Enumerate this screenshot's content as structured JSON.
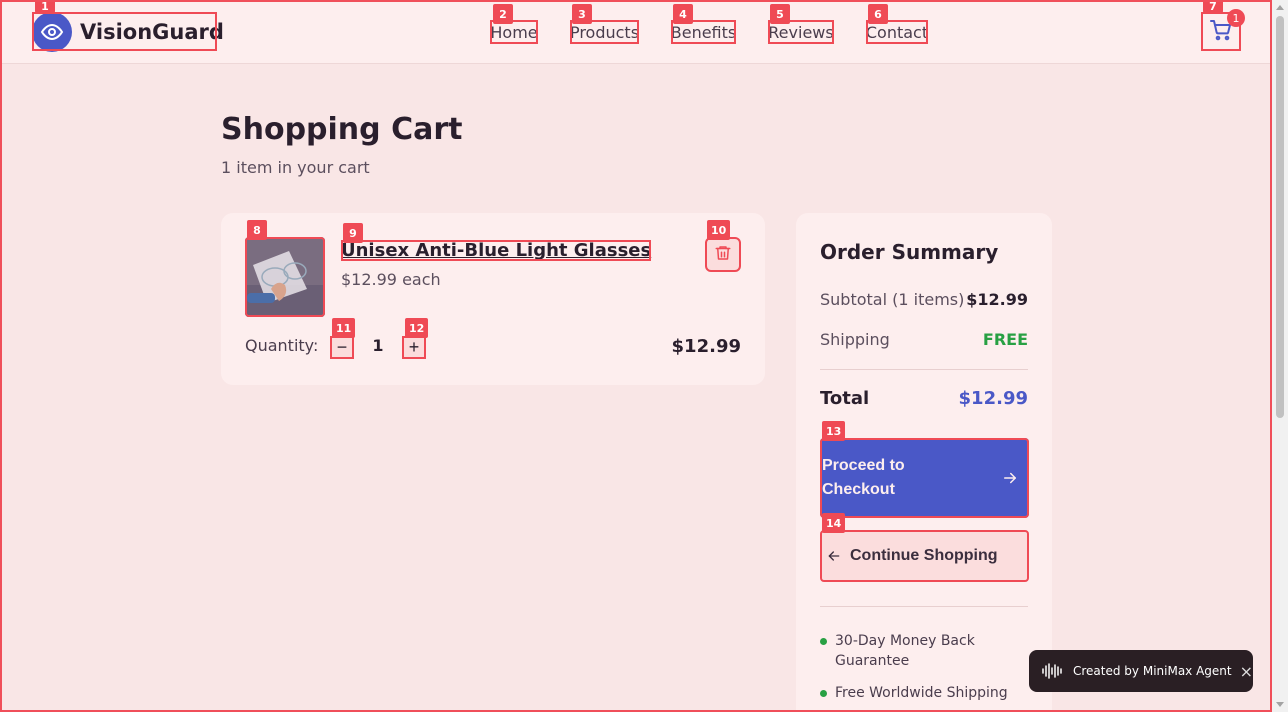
{
  "header": {
    "brand": "VisionGuard",
    "nav": [
      "Home",
      "Products",
      "Benefits",
      "Reviews",
      "Contact"
    ],
    "cart_count": "1"
  },
  "cart": {
    "title": "Shopping Cart",
    "subtitle": "1 item in your cart",
    "item": {
      "name": "Unisex Anti-Blue Light Glasses",
      "price_each": "$12.99 each",
      "quantity_label": "Quantity:",
      "quantity": "1",
      "decrement": "−",
      "increment": "+",
      "line_total": "$12.99"
    }
  },
  "summary": {
    "title": "Order Summary",
    "subtotal_label": "Subtotal (1 items)",
    "subtotal_value": "$12.99",
    "shipping_label": "Shipping",
    "shipping_value": "FREE",
    "total_label": "Total",
    "total_value": "$12.99",
    "checkout_label": "Proceed to Checkout",
    "continue_label": "Continue Shopping",
    "perks": [
      "30-Day Money Back Guarantee",
      "Free Worldwide Shipping"
    ]
  },
  "toast": {
    "text": "Created by MiniMax Agent",
    "close": "×"
  },
  "annotations": [
    "1",
    "2",
    "3",
    "4",
    "5",
    "6",
    "7",
    "8",
    "9",
    "10",
    "11",
    "12",
    "13",
    "14"
  ],
  "colors": {
    "accent": "#4a58c7",
    "highlight": "#ef4a55",
    "success": "#28a043",
    "background": "#f9e6e6"
  }
}
